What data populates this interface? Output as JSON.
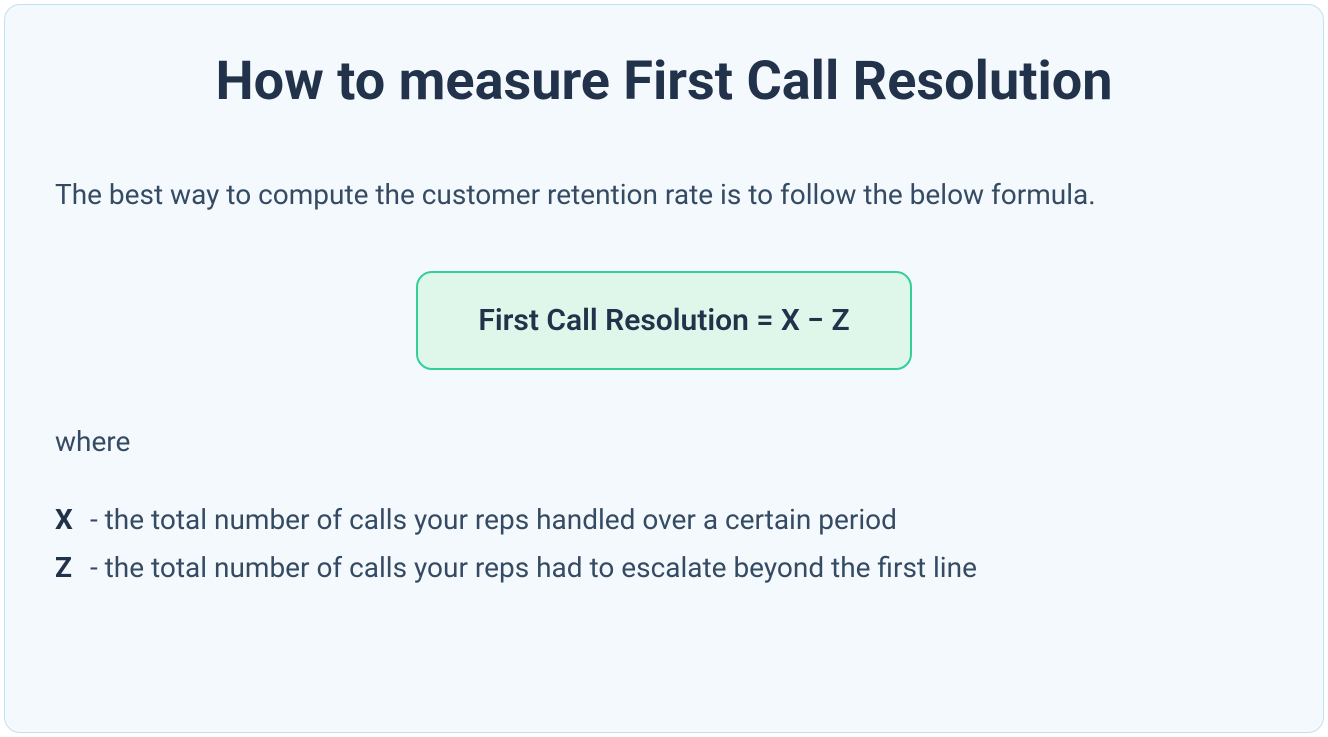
{
  "title": "How to measure First Call Resolution",
  "intro": "The best way to compute the customer retention rate is to follow the below formula.",
  "formula": "First Call Resolution = X − Z",
  "where_label": "where",
  "definitions": {
    "x": {
      "var": "X",
      "text": " - the total number of calls your reps handled over a certain period"
    },
    "z": {
      "var": "Z ",
      "text": " - the total number of calls your reps had to escalate beyond the first line"
    }
  }
}
